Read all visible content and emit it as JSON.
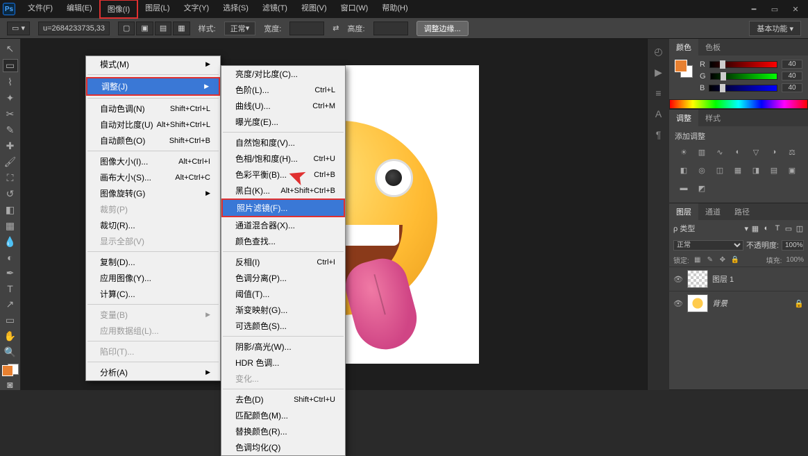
{
  "app": {
    "letters": "Ps"
  },
  "menubar": {
    "file": "文件(F)",
    "edit": "编辑(E)",
    "image": "图像(I)",
    "layer": "图层(L)",
    "text": "文字(Y)",
    "select": "选择(S)",
    "filter": "滤镜(T)",
    "view": "视图(V)",
    "window": "窗口(W)",
    "help": "帮助(H)"
  },
  "options": {
    "status": "u=2684233735,33",
    "style_label": "样式:",
    "style_value": "正常",
    "width_label": "宽度:",
    "height_label": "高度:",
    "refine": "调整边缘...",
    "essentials": "基本功能"
  },
  "dd1": {
    "mode": "模式(M)",
    "adjust": "调整(J)",
    "auto_tone": {
      "label": "自动色调(N)",
      "key": "Shift+Ctrl+L"
    },
    "auto_contrast": {
      "label": "自动对比度(U)",
      "key": "Alt+Shift+Ctrl+L"
    },
    "auto_color": {
      "label": "自动颜色(O)",
      "key": "Shift+Ctrl+B"
    },
    "img_size": {
      "label": "图像大小(I)...",
      "key": "Alt+Ctrl+I"
    },
    "canvas_size": {
      "label": "画布大小(S)...",
      "key": "Alt+Ctrl+C"
    },
    "rotate": "图像旋转(G)",
    "crop": "裁剪(P)",
    "trim": "裁切(R)...",
    "reveal": "显示全部(V)",
    "dup": "复制(D)...",
    "apply": "应用图像(Y)...",
    "calc": "计算(C)...",
    "variables": "变量(B)",
    "dataset": "应用数据组(L)...",
    "trap": "陷印(T)...",
    "analysis": "分析(A)"
  },
  "dd2": {
    "brightness": "亮度/对比度(C)...",
    "levels": {
      "label": "色阶(L)...",
      "key": "Ctrl+L"
    },
    "curves": {
      "label": "曲线(U)...",
      "key": "Ctrl+M"
    },
    "exposure": "曝光度(E)...",
    "vibrance": "自然饱和度(V)...",
    "hue": {
      "label": "色相/饱和度(H)...",
      "key": "Ctrl+U"
    },
    "balance": {
      "label": "色彩平衡(B)...",
      "key": "Ctrl+B"
    },
    "bw": {
      "label": "黑白(K)...",
      "key": "Alt+Shift+Ctrl+B"
    },
    "photo_filter": "照片滤镜(F)...",
    "mixer": "通道混合器(X)...",
    "lookup": "颜色查找...",
    "invert": {
      "label": "反相(I)",
      "key": "Ctrl+I"
    },
    "poster": "色调分离(P)...",
    "threshold": "阈值(T)...",
    "gradmap": "渐变映射(G)...",
    "selective": "可选颜色(S)...",
    "shadows": "阴影/高光(W)...",
    "hdr": "HDR 色调...",
    "variations": "变化...",
    "desat": {
      "label": "去色(D)",
      "key": "Shift+Ctrl+U"
    },
    "match": "匹配颜色(M)...",
    "replace": "替换颜色(R)...",
    "equalize": "色调均化(Q)"
  },
  "panels": {
    "color": {
      "tab1": "颜色",
      "tab2": "色板",
      "r": "R",
      "g": "G",
      "b": "B",
      "r_val": "40",
      "g_val": "40",
      "b_val": "40"
    },
    "adjust": {
      "tab1": "调整",
      "tab2": "样式",
      "title": "添加调整"
    },
    "layers": {
      "tab1": "图层",
      "tab2": "通道",
      "tab3": "路径",
      "kind": "ρ 类型",
      "blend": "正常",
      "opacity_label": "不透明度:",
      "opacity_val": "100%",
      "lock_label": "锁定:",
      "fill_label": "填充:",
      "fill_val": "100%",
      "layer1": "图层 1",
      "bg": "背景"
    }
  }
}
